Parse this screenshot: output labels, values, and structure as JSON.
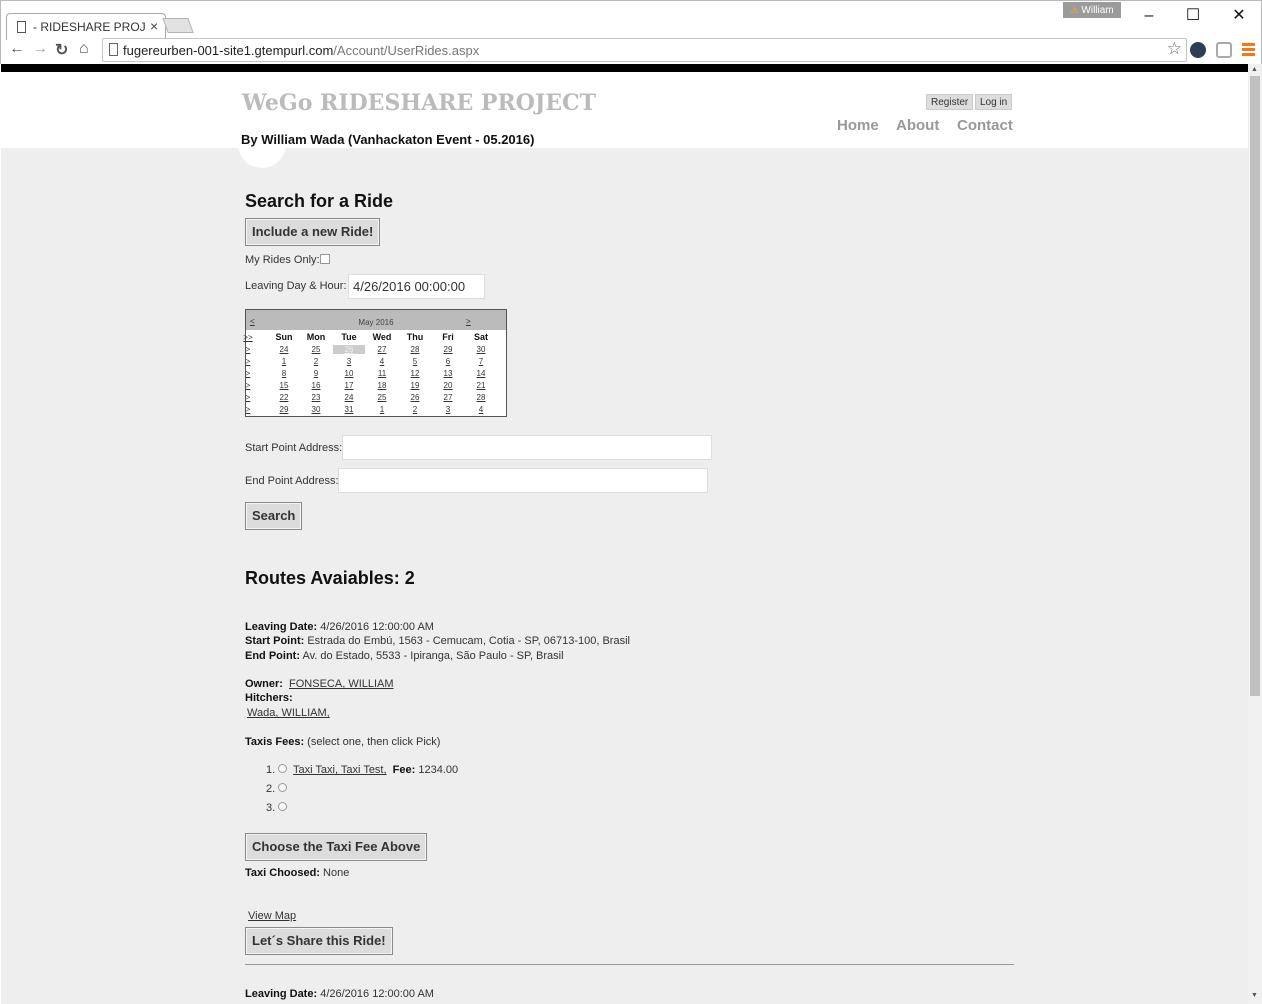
{
  "browser": {
    "tab_title": "- RIDESHARE PROJEC",
    "tab_close": "×",
    "profile_name": "William",
    "profile_warn": "⚠",
    "minimize": "–",
    "maximize": "☐",
    "close": "✕",
    "back": "←",
    "forward": "→",
    "reload": "↻",
    "home": "⌂",
    "url_host": "fugereurben-001-site1.gtempurl.com",
    "url_path": "/Account/UserRides.aspx",
    "star": "☆"
  },
  "header": {
    "site_title": "WeGo RIDESHARE PROJECT",
    "byline": "By William Wada (Vanhackaton Event - 05.2016)",
    "register": "Register",
    "login": "Log in",
    "nav": [
      "Home",
      "About",
      "Contact"
    ]
  },
  "search": {
    "title": "Search for a Ride",
    "include_button": "Include a new Ride!",
    "my_rides_label": "My Rides Only:",
    "leaving_label": "Leaving Day & Hour:",
    "leaving_value": "4/26/2016 00:00:00",
    "start_label": "Start Point Address:",
    "start_value": "",
    "end_label": "End Point Address:",
    "end_value": "",
    "search_button": "Search"
  },
  "calendar": {
    "prev": "<",
    "next": ">",
    "month": "May 2016",
    "select_month": ">>",
    "week_select": ">",
    "days_of_week": [
      "Sun",
      "Mon",
      "Tue",
      "Wed",
      "Thu",
      "Fri",
      "Sat"
    ],
    "weeks": [
      [
        "24",
        "25",
        "26",
        "27",
        "28",
        "29",
        "30"
      ],
      [
        "1",
        "2",
        "3",
        "4",
        "5",
        "6",
        "7"
      ],
      [
        "8",
        "9",
        "10",
        "11",
        "12",
        "13",
        "14"
      ],
      [
        "15",
        "16",
        "17",
        "18",
        "19",
        "20",
        "21"
      ],
      [
        "22",
        "23",
        "24",
        "25",
        "26",
        "27",
        "28"
      ],
      [
        "29",
        "30",
        "31",
        "1",
        "2",
        "3",
        "4"
      ]
    ],
    "selected": "26"
  },
  "routes": {
    "title": "Routes Avaiables: 2",
    "leaving_date_label": "Leaving Date:",
    "leaving_date": "4/26/2016 12:00:00 AM",
    "start_point_label": "Start Point:",
    "start_point": "Estrada do Embú, 1563 - Cemucam, Cotia - SP, 06713-100, Brasil",
    "end_point_label": "End Point:",
    "end_point": "Av. do Estado, 5533 - Ipiranga, São Paulo - SP, Brasil",
    "owner_label": "Owner:",
    "owner": "FONSECA, WILLIAM",
    "hitchers_label": "Hitchers:",
    "hitcher": "Wada, WILLIAM,",
    "taxis_label": "Taxis Fees:",
    "taxis_hint": "(select one, then click Pick)",
    "taxi_options": [
      {
        "num": "1.",
        "name": "Taxi Taxi, Taxi Test,",
        "fee_label": "Fee:",
        "fee": "1234.00"
      },
      {
        "num": "2.",
        "name": "",
        "fee_label": "",
        "fee": ""
      },
      {
        "num": "3.",
        "name": "",
        "fee_label": "",
        "fee": ""
      }
    ],
    "choose_button": "Choose the Taxi Fee Above",
    "taxi_choosed_label": "Taxi Choosed:",
    "taxi_choosed": "None",
    "view_map": "View Map",
    "share_button": "Let´s Share this Ride!",
    "second_leaving_label": "Leaving Date:",
    "second_leaving_date": "4/26/2016 12:00:00 AM"
  }
}
